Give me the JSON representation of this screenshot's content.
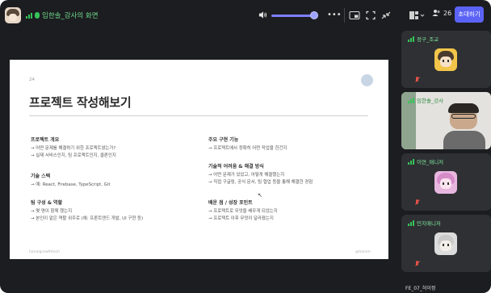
{
  "topbar": {
    "share_title": "임한솔_강사의 화면",
    "more_label": "•••",
    "participant_count": "26",
    "invite_label": "초대하기"
  },
  "slide": {
    "page_number": "24",
    "title": "프로젝트 작성해보기",
    "sections_left": [
      {
        "head": "프로젝트 개요",
        "lines": [
          "→ 어떤 문제를 해결하기 위한 프로젝트였는가?",
          "→ 실제 서비스인지, 팀 프로젝트인지, 클론인지"
        ]
      },
      {
        "head": "기술 스택",
        "lines": [
          "→ 예: React, Firebase, TypeScript, Git"
        ]
      },
      {
        "head": "팀 구성 & 역할",
        "lines": [
          "→ 몇 명이 함께 했는지",
          "→ 본인이 맡은 역할 위주로 (예: 프론트엔드 개발, UI 구현 등)"
        ]
      }
    ],
    "sections_right": [
      {
        "head": "주요 구현 기능",
        "lines": [
          "→ 프로젝트에서 정확히 어떤 작업을 한건지"
        ]
      },
      {
        "head": "기술적 어려움 & 해결 방식",
        "lines": [
          "→ 어떤 문제가 있었고, 어떻게 해결했는지",
          "→ 직접 구글링, 공식 문서, 팀 협업 등을 통해 해결한 경험"
        ]
      },
      {
        "head": "배운 점 / 성장 포인트",
        "lines": [
          "→ 프로젝트로 무엇을 배우게 되었는지",
          "→ 프로젝트 이후 무엇이 달라졌는지"
        ]
      }
    ],
    "footer_left": "hanolgrowthtech",
    "footer_right": "@hanim"
  },
  "participants": [
    {
      "name": "정구_조교"
    },
    {
      "name": "임한솔_강사"
    },
    {
      "name": "이연_매니저"
    },
    {
      "name": "민지매니저"
    },
    {
      "name": "FE_07_허이정"
    }
  ],
  "colors": {
    "accent": "#5b63f6",
    "speaking_green": "#37c35a",
    "muted_red": "#e0514a",
    "background": "#1c1d20"
  }
}
